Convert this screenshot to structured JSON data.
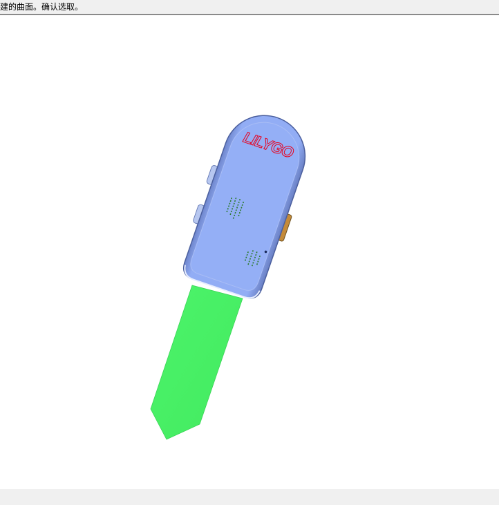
{
  "prompt": {
    "text": "建的曲面。确认选取。"
  },
  "model": {
    "logo_text": "LILYGO",
    "colors": {
      "body": "#92adf5",
      "body_shadow": "#5a6fb0",
      "body_highlight": "#c7d6ff",
      "paddle": "#4cf46a",
      "logo": "#e8001c",
      "holes": "#2b7a2b",
      "background": "#ffffff"
    }
  }
}
